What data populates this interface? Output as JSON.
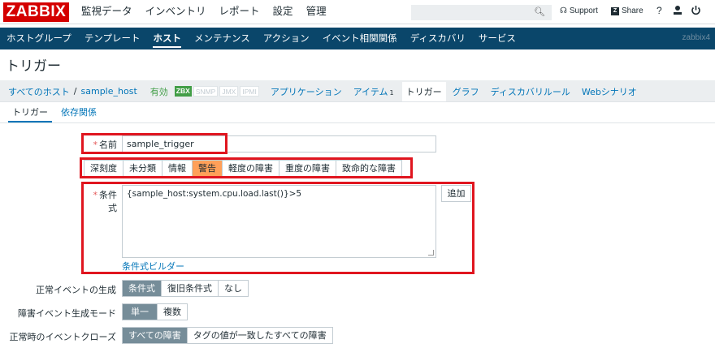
{
  "logo": "ZABBIX",
  "main_menu": [
    "監視データ",
    "インベントリ",
    "レポート",
    "設定",
    "管理"
  ],
  "util": {
    "support": "Support",
    "share": "Share",
    "help": "?"
  },
  "sub_menu": [
    "ホストグループ",
    "テンプレート",
    "ホスト",
    "メンテナンス",
    "アクション",
    "イベント相関関係",
    "ディスカバリ",
    "サービス"
  ],
  "server_name": "zabbix4",
  "page_title": "トリガー",
  "hostnav": {
    "all_hosts": "すべてのホスト",
    "separator": "/",
    "host": "sample_host",
    "status": "有効",
    "tags": [
      "ZBX",
      "SNMP",
      "JMX",
      "IPMI"
    ],
    "applications": "アプリケーション",
    "items": "アイテム",
    "items_count": "1",
    "triggers": "トリガー",
    "graphs": "グラフ",
    "discovery": "ディスカバリルール",
    "web": "Webシナリオ"
  },
  "tabs": [
    "トリガー",
    "依存関係"
  ],
  "form": {
    "required_mark": "*",
    "name_label": "名前",
    "name_value": "sample_trigger",
    "severity_label": "深刻度",
    "severity_options": [
      "未分類",
      "情報",
      "警告",
      "軽度の障害",
      "重度の障害",
      "致命的な障害"
    ],
    "severity_selected": "警告",
    "expression_label": "条件式",
    "expression_value": "{sample_host:system.cpu.load.last()}>5",
    "add_button": "追加",
    "expression_builder": "条件式ビルダー",
    "ok_event_label": "正常イベントの生成",
    "ok_event_options": [
      "条件式",
      "復旧条件式",
      "なし"
    ],
    "ok_event_selected": "条件式",
    "problem_mode_label": "障害イベント生成モード",
    "problem_mode_options": [
      "単一",
      "複数"
    ],
    "problem_mode_selected": "単一",
    "ok_close_label": "正常時のイベントクローズ",
    "ok_close_options": [
      "すべての障害",
      "タグの値が一致したすべての障害"
    ],
    "ok_close_selected": "すべての障害"
  },
  "colors": {
    "logo": "#d40000",
    "subbar": "#0a466a",
    "link": "#0275b8",
    "highlight": "#e0151f",
    "warning": "#ffa059"
  }
}
